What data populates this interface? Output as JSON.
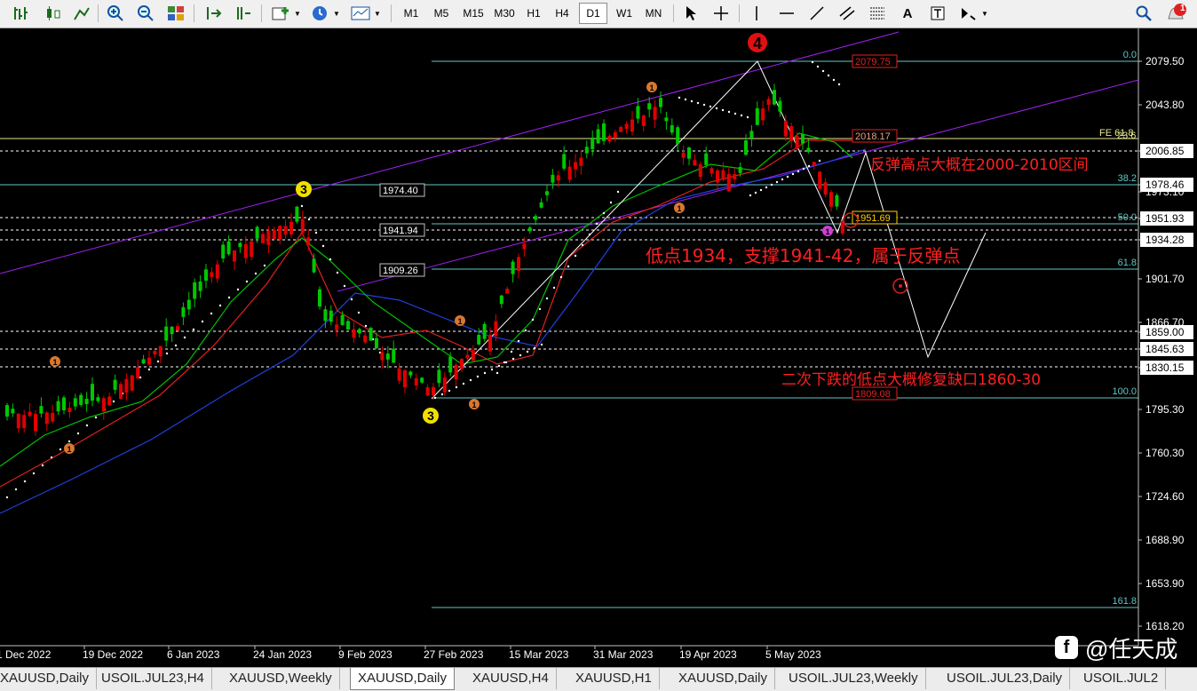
{
  "toolbar": {
    "timeframes": [
      "M1",
      "M5",
      "M15",
      "M30",
      "H1",
      "H4",
      "D1",
      "W1",
      "MN"
    ],
    "active_timeframe": "D1",
    "text_tool_label": "A",
    "notification_count": "1"
  },
  "chart": {
    "symbol": "XAUUSD,Daily",
    "price_axis": [
      "2079.50",
      "2043.80",
      "2006.85",
      "1978.46",
      "1973.10",
      "1951.93",
      "1934.28",
      "1901.70",
      "1866.70",
      "1859.00",
      "1845.63",
      "1830.15",
      "1795.30",
      "1760.30",
      "1724.60",
      "1688.90",
      "1653.90",
      "1618.20"
    ],
    "highlighted_prices": [
      "2006.85",
      "1978.46",
      "1951.93",
      "1934.28",
      "1859.00",
      "1845.63",
      "1830.15"
    ],
    "date_axis": [
      "1 Dec 2022",
      "19 Dec 2022",
      "6 Jan 2023",
      "24 Jan 2023",
      "9 Feb 2023",
      "27 Feb 2023",
      "15 Mar 2023",
      "31 Mar 2023",
      "19 Apr 2023",
      "5 May 2023"
    ],
    "fib_labels": [
      "0.0",
      "38.2",
      "50.0",
      "61.8",
      "100.0",
      "161.8",
      "FE 61.8",
      "23.6"
    ],
    "level_tags": [
      "1974.40",
      "1941.94",
      "1909.26",
      "2079.75",
      "2018.17",
      "1951.69",
      "1809.08"
    ],
    "wave_labels": [
      "4",
      "3",
      "3"
    ],
    "small_wave_labels": [
      "1",
      "1",
      "1",
      "1",
      "1",
      "1",
      "1"
    ],
    "annotations": {
      "rebound_high": "反弹高点大概在2000-2010区间",
      "low_support": "低点1934，支撑1941-42，属于反弹点",
      "second_drop": "二次下跌的低点大概修复缺口1860-30"
    }
  },
  "tabs": [
    "XAUUSD,Daily",
    "USOIL.JUL23,H4",
    "XAUUSD,Weekly",
    "XAUUSD,Daily",
    "XAUUSD,H4",
    "XAUUSD,H1",
    "XAUUSD,Daily",
    "USOIL.JUL23,Weekly",
    "USOIL.JUL23,Daily",
    "USOIL.JUL2"
  ],
  "active_tab_index": 3,
  "watermark": {
    "handle": "@任天成",
    "logo": "f"
  },
  "colors": {
    "bull": "#00c800",
    "bear": "#e00000",
    "fib": "#5fc8c8",
    "channel": "#a020f0",
    "annotation": "#ff2020"
  }
}
